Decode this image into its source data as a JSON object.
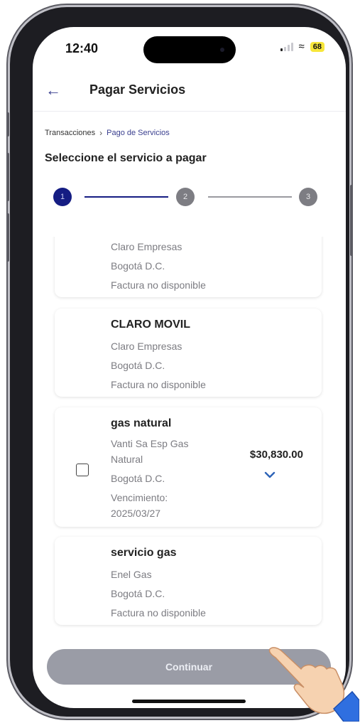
{
  "status": {
    "time": "12:40",
    "battery": "68"
  },
  "header": {
    "title": "Pagar Servicios"
  },
  "breadcrumb": {
    "root": "Transacciones",
    "current": "Pago de Servicios"
  },
  "subtitle": "Seleccione el servicio a pagar",
  "stepper": {
    "steps": [
      "1",
      "2",
      "3"
    ],
    "active_step": 1
  },
  "services": [
    {
      "title": "",
      "lines": [
        "Claro Empresas",
        "Bogotá D.C.",
        "Factura no disponible"
      ]
    },
    {
      "title": "CLARO MOVIL",
      "lines": [
        "Claro Empresas",
        "Bogotá D.C.",
        "Factura no disponible"
      ]
    },
    {
      "title": "gas natural",
      "lines": [
        "Vanti Sa Esp Gas",
        "Natural",
        "Bogotá D.C.",
        "Vencimiento:",
        "2025/03/27"
      ],
      "amount": "$30,830.00"
    },
    {
      "title": "servicio gas",
      "lines": [
        "Enel Gas",
        "Bogotá D.C.",
        "Factura no disponible"
      ]
    }
  ],
  "continue_label": "Continuar",
  "colors": {
    "primary": "#151d83",
    "accent_text": "#3a3f8f",
    "button_disabled": "#9a9ca6"
  }
}
